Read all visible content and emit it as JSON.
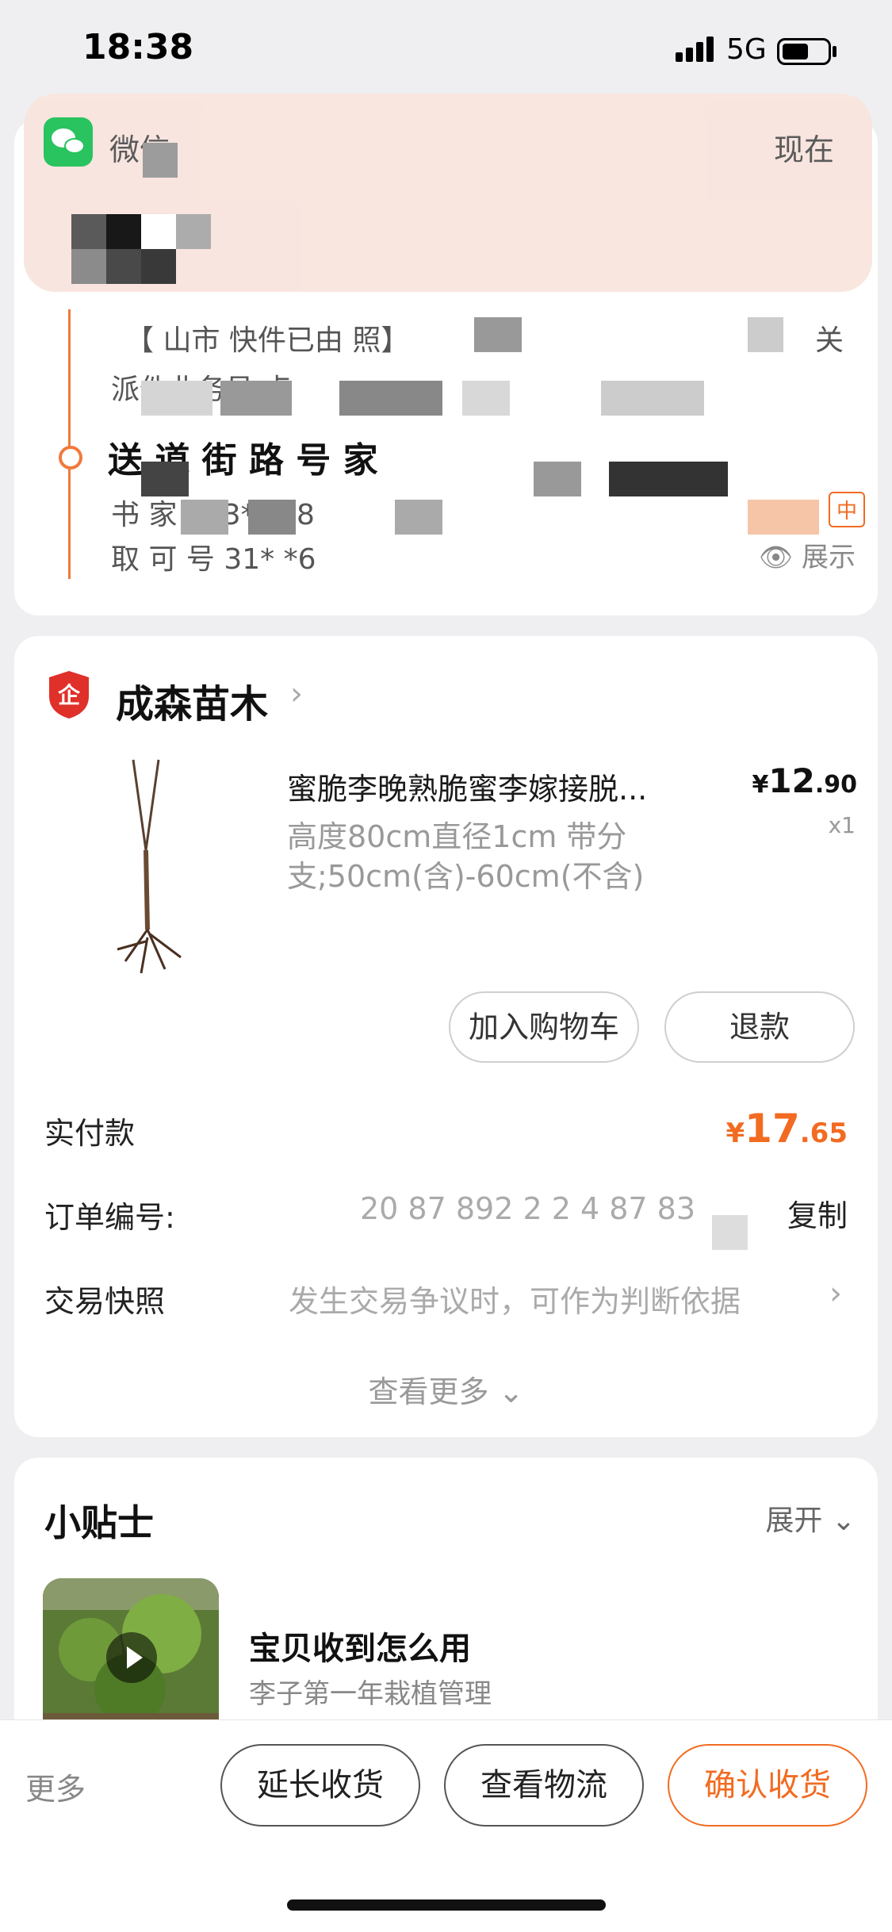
{
  "status_bar": {
    "time": "18:38",
    "network": "5G"
  },
  "notification": {
    "app": "微信",
    "time": "现在"
  },
  "logistics": {
    "line1": "【 山市 快件已由 照】",
    "line1_end": "关",
    "line2": "派件业务员 点",
    "address_bold": "送 道 街 路 号 家",
    "contact": "书 家 153* *38",
    "pickup": "取 可 号 31* *6",
    "privacy_tag": "中",
    "show_label": "展示"
  },
  "shop": {
    "name": "成森苗木",
    "badge": "企"
  },
  "product": {
    "title": "蜜脆李晚熟脆蜜李嫁接脱...",
    "price_symbol": "¥",
    "price_int": "12",
    "price_dec": ".90",
    "qty": "x1",
    "spec": "高度80cm直径1cm 带分支;50cm(含)-60cm(不含)"
  },
  "buttons": {
    "add_cart": "加入购物车",
    "refund": "退款"
  },
  "payment": {
    "label": "实付款",
    "symbol": "¥",
    "amount_int": "17",
    "amount_dec": ".65"
  },
  "order": {
    "no_label": "订单编号:",
    "no_value": "20 87 892 2 2 4 87 83",
    "copy": "复制",
    "snapshot_label": "交易快照",
    "snapshot_hint": "发生交易争议时，可作为判断依据",
    "see_more": "查看更多"
  },
  "tips": {
    "title": "小贴士",
    "expand": "展开",
    "heading": "宝贝收到怎么用",
    "sub": "李子第一年栽植管理"
  },
  "bottom": {
    "more": "更多",
    "extend": "延长收货",
    "logistics": "查看物流",
    "confirm": "确认收货"
  },
  "colors": {
    "accent": "#f26b21",
    "wechat": "#23c25a",
    "badge_red": "#e0302a"
  },
  "icons": [
    "wechat-icon",
    "signal-icon",
    "battery-icon",
    "shop-badge-icon",
    "eye-icon",
    "play-icon",
    "chevron-right-icon",
    "chevron-down-icon"
  ]
}
